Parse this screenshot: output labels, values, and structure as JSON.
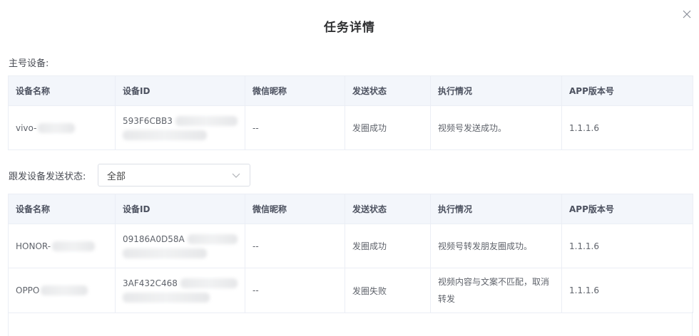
{
  "dialog": {
    "title": "任务详情",
    "close_icon": "close-icon"
  },
  "main_section": {
    "label": "主号设备:",
    "columns": [
      "设备名称",
      "设备ID",
      "微信昵称",
      "发送状态",
      "执行情况",
      "APP版本号"
    ],
    "rows": [
      {
        "device_name": "vivo-",
        "device_id": "593F6CBB3",
        "nickname": "--",
        "send_status": "发圈成功",
        "execution": "视频号发送成功。",
        "app_version": "1.1.1.6"
      }
    ]
  },
  "follow_section": {
    "label": "跟发设备发送状态:",
    "filter": {
      "value": "全部",
      "icon": "chevron-down-icon"
    },
    "columns": [
      "设备名称",
      "设备ID",
      "微信昵称",
      "发送状态",
      "执行情况",
      "APP版本号"
    ],
    "rows": [
      {
        "device_name": "HONOR-",
        "device_id": "09186A0D58A",
        "nickname": "--",
        "send_status": "发圈成功",
        "execution": "视频号转发朋友圈成功。",
        "app_version": "1.1.1.6"
      },
      {
        "device_name": "OPPO",
        "device_id": "3AF432C468",
        "nickname": "--",
        "send_status": "发圈失败",
        "execution_line1": "视频内容与文案不匹配，取消",
        "execution_line2": "转发",
        "app_version": "1.1.1.6"
      }
    ]
  }
}
